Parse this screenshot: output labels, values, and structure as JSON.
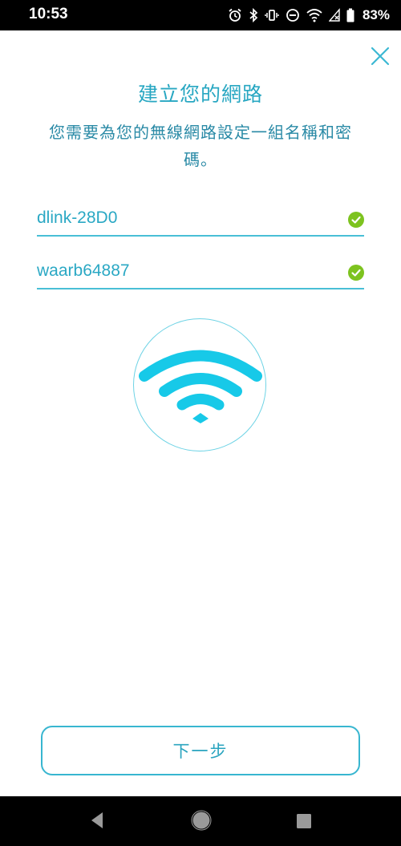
{
  "status_bar": {
    "time": "10:53",
    "battery_percent": "83%",
    "icons": [
      "alarm-icon",
      "bluetooth-icon",
      "vibrate-icon",
      "do-not-disturb-icon",
      "wifi-icon",
      "no-signal-icon",
      "battery-icon"
    ]
  },
  "header": {
    "close_icon": "close-icon",
    "title": "建立您的網路",
    "subtitle": "您需要為您的無線網路設定一組名稱和密碼。"
  },
  "form": {
    "network_name": {
      "value": "dlink-28D0",
      "valid": true
    },
    "password": {
      "value": "waarb64887",
      "valid": true
    }
  },
  "illustration": {
    "icon": "wifi-illustration-icon"
  },
  "actions": {
    "next_label": "下一步"
  },
  "nav_bar": {
    "buttons": [
      "back-icon",
      "home-icon",
      "recents-icon"
    ]
  },
  "colors": {
    "accent": "#28a7c2",
    "wifi_arc": "#17c9e8",
    "check": "#7dc31f",
    "border": "#49bfd6"
  }
}
